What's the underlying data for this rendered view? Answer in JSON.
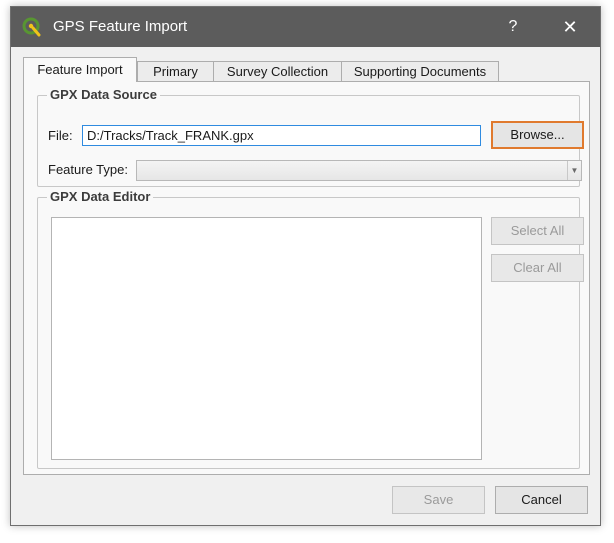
{
  "window": {
    "title": "GPS Feature Import",
    "help_label": "?",
    "close_label": "✕"
  },
  "tabs": [
    {
      "label": "Feature Import",
      "active": true
    },
    {
      "label": "Primary",
      "active": false
    },
    {
      "label": "Survey Collection",
      "active": false
    },
    {
      "label": "Supporting Documents",
      "active": false
    }
  ],
  "source_group": {
    "title": "GPX Data Source",
    "file_label": "File:",
    "file_value": "D:/Tracks/Track_FRANK.gpx",
    "browse_label": "Browse...",
    "feature_type_label": "Feature Type:",
    "feature_type_value": ""
  },
  "editor_group": {
    "title": "GPX Data Editor",
    "select_all_label": "Select All",
    "clear_all_label": "Clear All",
    "items": []
  },
  "footer": {
    "save_label": "Save",
    "cancel_label": "Cancel"
  },
  "colors": {
    "titlebar": "#5c5c5c",
    "focus_accent": "#e07a2e",
    "input_focus": "#2f8be0",
    "qgis_green": "#589632",
    "qgis_yellow": "#f0c419"
  }
}
